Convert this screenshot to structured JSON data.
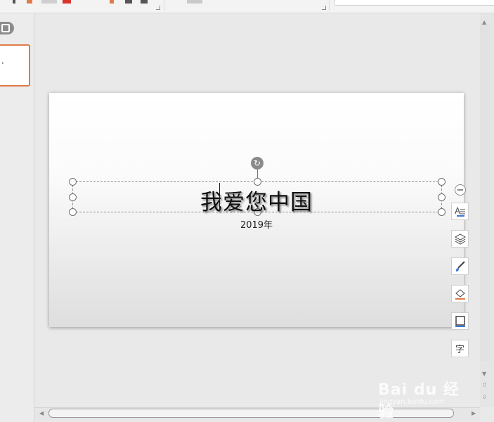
{
  "slide": {
    "title": "我爱您中国",
    "subtitle": "2019年"
  },
  "right_toolbar": {
    "items": [
      {
        "icon": "text-style-icon",
        "label": "A"
      },
      {
        "icon": "layers-icon",
        "label": ""
      },
      {
        "icon": "brush-icon",
        "label": ""
      },
      {
        "icon": "fill-bucket-icon",
        "label": ""
      },
      {
        "icon": "outline-icon",
        "label": ""
      },
      {
        "icon": "character-spacing-icon",
        "label": "字"
      }
    ]
  },
  "watermark": {
    "main": "Bai du 经验",
    "sub": "jingyan.baidu.com"
  },
  "colors": {
    "thumb_border": "#e07b47",
    "accent_orange": "#e07b47",
    "accent_red": "#d9342b"
  }
}
